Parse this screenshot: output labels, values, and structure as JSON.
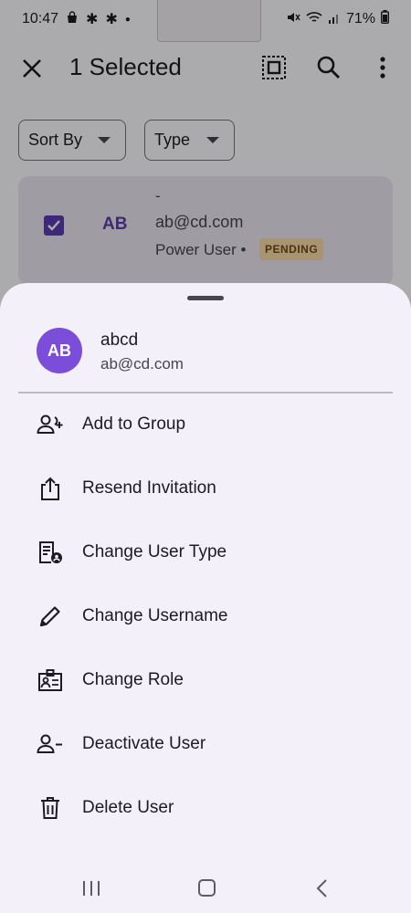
{
  "status_bar": {
    "time": "10:47",
    "battery": "71%"
  },
  "app_bar": {
    "title": "1 Selected",
    "close_icon": "close-icon",
    "select_all_icon": "select-all-icon",
    "search_icon": "search-icon",
    "more_icon": "more-vert-icon"
  },
  "filters": {
    "sort_by": "Sort By",
    "type": "Type"
  },
  "user_card": {
    "initials": "AB",
    "display_name": "-",
    "email": "ab@cd.com",
    "role": "Power User •",
    "status": "PENDING",
    "checked": true
  },
  "sheet": {
    "avatar_initials": "AB",
    "name": "abcd",
    "email": "ab@cd.com",
    "items": [
      {
        "label": "Add to Group",
        "icon": "add-person-icon"
      },
      {
        "label": "Resend Invitation",
        "icon": "share-icon"
      },
      {
        "label": "Change User Type",
        "icon": "user-type-icon"
      },
      {
        "label": "Change Username",
        "icon": "pencil-icon"
      },
      {
        "label": "Change Role",
        "icon": "id-badge-icon"
      },
      {
        "label": "Deactivate User",
        "icon": "remove-person-icon"
      },
      {
        "label": "Delete User",
        "icon": "trash-icon"
      }
    ]
  },
  "colors": {
    "accent": "#5b3db0",
    "avatar": "#7c4dd8",
    "sheet_bg": "#f3f0fa",
    "pending_bg": "#f8dba8"
  }
}
